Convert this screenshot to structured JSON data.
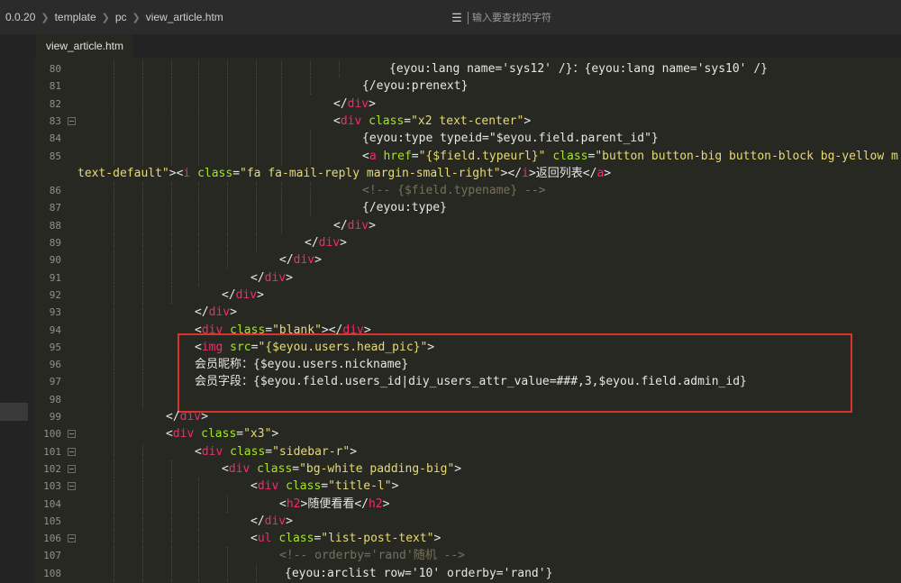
{
  "breadcrumb": [
    "0.0.20",
    "template",
    "pc",
    "view_article.htm"
  ],
  "search": {
    "placeholder": "输入要查找的字符",
    "icon": "search-icon"
  },
  "tab": {
    "label": "view_article.htm"
  },
  "colors": {
    "background": "#272822",
    "tag": "#f92672",
    "attr": "#a6e22e",
    "string": "#e6db74",
    "comment": "#75715e",
    "highlight_box": "#d9342b"
  },
  "editor": {
    "lines": [
      {
        "num": "80",
        "indent": 352,
        "segments": [
          [
            "t",
            "{eyou:lang name='sys12' /}："
          ],
          [
            "t",
            "{eyou:lang name='sys10' /}"
          ]
        ]
      },
      {
        "num": "81",
        "indent": 322,
        "segments": [
          [
            "t",
            "{/eyou:prenext}"
          ]
        ]
      },
      {
        "num": "82",
        "indent": 290,
        "segments": [
          [
            "g",
            "</"
          ],
          [
            "tag",
            "div"
          ],
          [
            "g",
            ">"
          ]
        ]
      },
      {
        "num": "83",
        "indent": 290,
        "fold": true,
        "segments": [
          [
            "g",
            "<"
          ],
          [
            "tag",
            "div"
          ],
          [
            "t",
            " "
          ],
          [
            "attr",
            "class"
          ],
          [
            "t",
            "="
          ],
          [
            "str",
            "\"x2 text-center\""
          ],
          [
            "g",
            ">"
          ]
        ]
      },
      {
        "num": "84",
        "indent": 322,
        "segments": [
          [
            "t",
            "{eyou:type typeid=\"$eyou.field.parent_id\"}"
          ]
        ]
      },
      {
        "num": "85",
        "indent": 322,
        "segments": [
          [
            "g",
            "<"
          ],
          [
            "tag",
            "a"
          ],
          [
            "t",
            " "
          ],
          [
            "attr",
            "href"
          ],
          [
            "t",
            "="
          ],
          [
            "str",
            "\"{$field.typeurl}\""
          ],
          [
            "t",
            " "
          ],
          [
            "attr",
            "class"
          ],
          [
            "t",
            "="
          ],
          [
            "str",
            "\"button button-big button-block bg-yellow m"
          ]
        ]
      },
      {
        "num": "",
        "indent": 8,
        "segments": [
          [
            "str",
            "text-default\""
          ],
          [
            "g",
            ">"
          ],
          [
            "g",
            "<"
          ],
          [
            "tag",
            "i"
          ],
          [
            "t",
            " "
          ],
          [
            "attr",
            "class"
          ],
          [
            "t",
            "="
          ],
          [
            "str",
            "\"fa fa-mail-reply margin-small-right\""
          ],
          [
            "g",
            ">"
          ],
          [
            "g",
            "</"
          ],
          [
            "tag",
            "i"
          ],
          [
            "g",
            ">"
          ],
          [
            "t",
            "返回列表"
          ],
          [
            "g",
            "</"
          ],
          [
            "tag",
            "a"
          ],
          [
            "g",
            ">"
          ]
        ]
      },
      {
        "num": "86",
        "indent": 322,
        "segments": [
          [
            "cmt",
            "<!-- {$field.typename} -->"
          ]
        ]
      },
      {
        "num": "87",
        "indent": 322,
        "segments": [
          [
            "t",
            "{/eyou:type}"
          ]
        ]
      },
      {
        "num": "88",
        "indent": 290,
        "segments": [
          [
            "g",
            "</"
          ],
          [
            "tag",
            "div"
          ],
          [
            "g",
            ">"
          ]
        ]
      },
      {
        "num": "89",
        "indent": 258,
        "segments": [
          [
            "g",
            "</"
          ],
          [
            "tag",
            "div"
          ],
          [
            "g",
            ">"
          ]
        ]
      },
      {
        "num": "90",
        "indent": 230,
        "segments": [
          [
            "g",
            "</"
          ],
          [
            "tag",
            "div"
          ],
          [
            "g",
            ">"
          ]
        ]
      },
      {
        "num": "91",
        "indent": 198,
        "segments": [
          [
            "g",
            "</"
          ],
          [
            "tag",
            "div"
          ],
          [
            "g",
            ">"
          ]
        ]
      },
      {
        "num": "92",
        "indent": 166,
        "segments": [
          [
            "g",
            "</"
          ],
          [
            "tag",
            "div"
          ],
          [
            "g",
            ">"
          ]
        ]
      },
      {
        "num": "93",
        "indent": 136,
        "segments": [
          [
            "g",
            "</"
          ],
          [
            "tag",
            "div"
          ],
          [
            "g",
            ">"
          ]
        ]
      },
      {
        "num": "94",
        "indent": 136,
        "segments": [
          [
            "g",
            "<"
          ],
          [
            "tag",
            "div"
          ],
          [
            "t",
            " "
          ],
          [
            "attr",
            "class"
          ],
          [
            "t",
            "="
          ],
          [
            "str",
            "\"blank\""
          ],
          [
            "g",
            ">"
          ],
          [
            "g",
            "</"
          ],
          [
            "tag",
            "div"
          ],
          [
            "g",
            ">"
          ]
        ]
      },
      {
        "num": "95",
        "indent": 136,
        "segments": [
          [
            "g",
            "<"
          ],
          [
            "tag",
            "img"
          ],
          [
            "t",
            " "
          ],
          [
            "attr",
            "src"
          ],
          [
            "t",
            "="
          ],
          [
            "str",
            "\"{$eyou.users.head_pic}\""
          ],
          [
            "g",
            ">"
          ]
        ]
      },
      {
        "num": "96",
        "indent": 136,
        "segments": [
          [
            "t",
            "会员昵称：{$eyou.users.nickname}"
          ]
        ]
      },
      {
        "num": "97",
        "indent": 136,
        "segments": [
          [
            "t",
            "会员字段：{$eyou.field.users_id|diy_users_attr_value=###,3,$eyou.field.admin_id}"
          ]
        ]
      },
      {
        "num": "98",
        "indent": 136,
        "segments": []
      },
      {
        "num": "99",
        "indent": 104,
        "segments": [
          [
            "g",
            "</"
          ],
          [
            "tag",
            "div"
          ],
          [
            "g",
            ">"
          ]
        ]
      },
      {
        "num": "100",
        "indent": 104,
        "fold": true,
        "segments": [
          [
            "g",
            "<"
          ],
          [
            "tag",
            "div"
          ],
          [
            "t",
            " "
          ],
          [
            "attr",
            "class"
          ],
          [
            "t",
            "="
          ],
          [
            "str",
            "\"x3\""
          ],
          [
            "g",
            ">"
          ]
        ]
      },
      {
        "num": "101",
        "indent": 136,
        "fold": true,
        "segments": [
          [
            "g",
            "<"
          ],
          [
            "tag",
            "div"
          ],
          [
            "t",
            " "
          ],
          [
            "attr",
            "class"
          ],
          [
            "t",
            "="
          ],
          [
            "str",
            "\"sidebar-r\""
          ],
          [
            "g",
            ">"
          ]
        ]
      },
      {
        "num": "102",
        "indent": 166,
        "fold": true,
        "segments": [
          [
            "g",
            "<"
          ],
          [
            "tag",
            "div"
          ],
          [
            "t",
            " "
          ],
          [
            "attr",
            "class"
          ],
          [
            "t",
            "="
          ],
          [
            "str",
            "\"bg-white padding-big\""
          ],
          [
            "g",
            ">"
          ]
        ]
      },
      {
        "num": "103",
        "indent": 198,
        "fold": true,
        "segments": [
          [
            "g",
            "<"
          ],
          [
            "tag",
            "div"
          ],
          [
            "t",
            " "
          ],
          [
            "attr",
            "class"
          ],
          [
            "t",
            "="
          ],
          [
            "str",
            "\"title-l\""
          ],
          [
            "g",
            ">"
          ]
        ]
      },
      {
        "num": "104",
        "indent": 230,
        "segments": [
          [
            "g",
            "<"
          ],
          [
            "tag",
            "h2"
          ],
          [
            "g",
            ">"
          ],
          [
            "t",
            "随便看看"
          ],
          [
            "g",
            "</"
          ],
          [
            "tag",
            "h2"
          ],
          [
            "g",
            ">"
          ]
        ]
      },
      {
        "num": "105",
        "indent": 198,
        "segments": [
          [
            "g",
            "</"
          ],
          [
            "tag",
            "div"
          ],
          [
            "g",
            ">"
          ]
        ]
      },
      {
        "num": "106",
        "indent": 198,
        "fold": true,
        "segments": [
          [
            "g",
            "<"
          ],
          [
            "tag",
            "ul"
          ],
          [
            "t",
            " "
          ],
          [
            "attr",
            "class"
          ],
          [
            "t",
            "="
          ],
          [
            "str",
            "\"list-post-text\""
          ],
          [
            "g",
            ">"
          ]
        ]
      },
      {
        "num": "107",
        "indent": 230,
        "segments": [
          [
            "cmt",
            "<!-- orderby='rand'随机 -->"
          ]
        ]
      },
      {
        "num": "108",
        "indent": 236,
        "segments": [
          [
            "t",
            "{eyou:arclist row='10' orderby='rand'}"
          ]
        ]
      }
    ]
  }
}
